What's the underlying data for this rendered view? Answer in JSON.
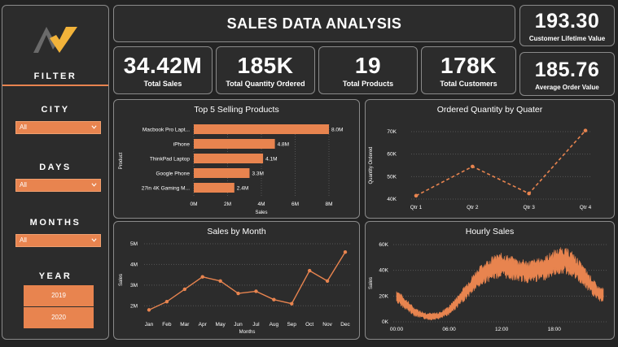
{
  "header": {
    "title": "SALES DATA ANALYSIS"
  },
  "sidebar": {
    "filter_label": "FILTER",
    "city": {
      "label": "CITY",
      "value": "All"
    },
    "days": {
      "label": "DAYS",
      "value": "All"
    },
    "months": {
      "label": "MONTHS",
      "value": "All"
    },
    "year": {
      "label": "YEAR",
      "options": [
        "2019",
        "2020"
      ]
    }
  },
  "kpis": {
    "total_sales": {
      "value": "34.42M",
      "label": "Total Sales"
    },
    "total_quantity": {
      "value": "185K",
      "label": "Total Quantity Ordered"
    },
    "total_products": {
      "value": "19",
      "label": "Total Products"
    },
    "total_customers": {
      "value": "178K",
      "label": "Total Customers"
    },
    "clv": {
      "value": "193.30",
      "label": "Customer Lifetime Value"
    },
    "aov": {
      "value": "185.76",
      "label": "Average Order Value"
    }
  },
  "colors": {
    "accent": "#e8844f",
    "panel": "#2c2c2c",
    "border": "#8a8a8a",
    "background": "#232323"
  },
  "chart_data": [
    {
      "type": "bar",
      "title": "Top 5 Selling Products",
      "orientation": "horizontal",
      "xlabel": "Sales",
      "ylabel": "Product",
      "categories": [
        "Macbook Pro Lapt...",
        "iPhone",
        "ThinkPad Laptop",
        "Google Phone",
        "27in 4K Gaming M..."
      ],
      "values": [
        8.0,
        4.8,
        4.1,
        3.3,
        2.4
      ],
      "data_labels": [
        "8.0M",
        "4.8M",
        "4.1M",
        "3.3M",
        "2.4M"
      ],
      "xticks": [
        "0M",
        "2M",
        "4M",
        "6M",
        "8M"
      ],
      "xlim": [
        0,
        8
      ]
    },
    {
      "type": "line",
      "title": "Ordered Quantity by Quater",
      "ylabel": "Quantity Ordered",
      "categories": [
        "Qtr 1",
        "Qtr 2",
        "Qtr 3",
        "Qtr 4"
      ],
      "values": [
        41500,
        54500,
        42500,
        70500
      ],
      "yticks": [
        "40K",
        "50K",
        "60K",
        "70K"
      ],
      "ylim": [
        40000,
        70000
      ],
      "line_style": "dashed"
    },
    {
      "type": "line",
      "title": "Sales by Month",
      "xlabel": "Months",
      "ylabel": "Sales",
      "categories": [
        "Jan",
        "Feb",
        "Mar",
        "Apr",
        "May",
        "Jun",
        "Jul",
        "Aug",
        "Sep",
        "Oct",
        "Nov",
        "Dec"
      ],
      "values": [
        1.8,
        2.2,
        2.8,
        3.4,
        3.2,
        2.6,
        2.7,
        2.3,
        2.1,
        3.7,
        3.2,
        4.6
      ],
      "yticks": [
        "2M",
        "3M",
        "4M",
        "5M"
      ],
      "ylim": [
        1.5,
        5
      ]
    },
    {
      "type": "area",
      "title": "Hourly Sales",
      "ylabel": "Sales",
      "xticks": [
        "00:00",
        "06:00",
        "12:00",
        "18:00"
      ],
      "yticks": [
        "0K",
        "20K",
        "40K",
        "60K"
      ],
      "ylim": [
        0,
        60
      ],
      "hourly_levels": [
        20,
        14,
        8,
        5,
        4,
        5,
        9,
        16,
        24,
        32,
        38,
        42,
        44,
        42,
        40,
        39,
        40,
        42,
        46,
        48,
        45,
        38,
        30,
        22
      ]
    }
  ]
}
